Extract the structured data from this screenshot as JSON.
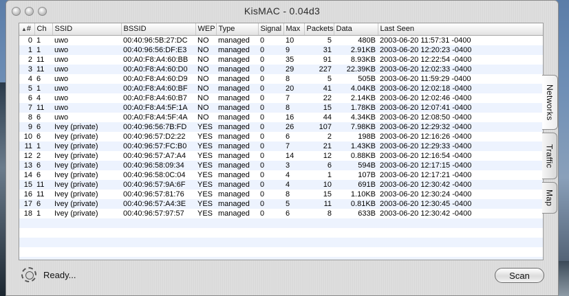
{
  "window": {
    "title": "KisMAC - 0.04d3"
  },
  "columns": {
    "sort": "▲",
    "num": "#",
    "ch": "Ch",
    "ssid": "SSID",
    "bssid": "BSSID",
    "wep": "WEP",
    "type": "Type",
    "signal": "Signal",
    "max": "Max",
    "packets": "Packets",
    "data": "Data",
    "last_seen": "Last Seen"
  },
  "rows": [
    {
      "num": "0",
      "ch": "1",
      "ssid": "uwo",
      "bssid": "00:40:96:5B:27:DC",
      "wep": "NO",
      "type": "managed",
      "signal": "0",
      "max": "10",
      "packets": "5",
      "data": "480B",
      "last_seen": "2003-06-20 11:57:31 -0400"
    },
    {
      "num": "1",
      "ch": "1",
      "ssid": "uwo",
      "bssid": "00:40:96:56:DF:E3",
      "wep": "NO",
      "type": "managed",
      "signal": "0",
      "max": "9",
      "packets": "31",
      "data": "2.91KB",
      "last_seen": "2003-06-20 12:20:23 -0400"
    },
    {
      "num": "2",
      "ch": "11",
      "ssid": "uwo",
      "bssid": "00:A0:F8:A4:60:BB",
      "wep": "NO",
      "type": "managed",
      "signal": "0",
      "max": "35",
      "packets": "91",
      "data": "8.93KB",
      "last_seen": "2003-06-20 12:22:54 -0400"
    },
    {
      "num": "3",
      "ch": "11",
      "ssid": "uwo",
      "bssid": "00:A0:F8:A4:60:D0",
      "wep": "NO",
      "type": "managed",
      "signal": "0",
      "max": "29",
      "packets": "227",
      "data": "22.39KB",
      "last_seen": "2003-06-20 12:02:33 -0400"
    },
    {
      "num": "4",
      "ch": "6",
      "ssid": "uwo",
      "bssid": "00:A0:F8:A4:60:D9",
      "wep": "NO",
      "type": "managed",
      "signal": "0",
      "max": "8",
      "packets": "5",
      "data": "505B",
      "last_seen": "2003-06-20 11:59:29 -0400"
    },
    {
      "num": "5",
      "ch": "1",
      "ssid": "uwo",
      "bssid": "00:A0:F8:A4:60:BF",
      "wep": "NO",
      "type": "managed",
      "signal": "0",
      "max": "20",
      "packets": "41",
      "data": "4.04KB",
      "last_seen": "2003-06-20 12:02:18 -0400"
    },
    {
      "num": "6",
      "ch": "4",
      "ssid": "uwo",
      "bssid": "00:A0:F8:A4:60:B7",
      "wep": "NO",
      "type": "managed",
      "signal": "0",
      "max": "7",
      "packets": "22",
      "data": "2.14KB",
      "last_seen": "2003-06-20 12:02:46 -0400"
    },
    {
      "num": "7",
      "ch": "11",
      "ssid": "uwo",
      "bssid": "00:A0:F8:A4:5F:1A",
      "wep": "NO",
      "type": "managed",
      "signal": "0",
      "max": "8",
      "packets": "15",
      "data": "1.78KB",
      "last_seen": "2003-06-20 12:07:41 -0400"
    },
    {
      "num": "8",
      "ch": "6",
      "ssid": "uwo",
      "bssid": "00:A0:F8:A4:5F:4A",
      "wep": "NO",
      "type": "managed",
      "signal": "0",
      "max": "16",
      "packets": "44",
      "data": "4.34KB",
      "last_seen": "2003-06-20 12:08:50 -0400"
    },
    {
      "num": "9",
      "ch": "6",
      "ssid": "Ivey (private)",
      "bssid": "00:40:96:56:7B:FD",
      "wep": "YES",
      "type": "managed",
      "signal": "0",
      "max": "26",
      "packets": "107",
      "data": "7.98KB",
      "last_seen": "2003-06-20 12:29:32 -0400"
    },
    {
      "num": "10",
      "ch": "6",
      "ssid": "Ivey (private)",
      "bssid": "00:40:96:57:D2:22",
      "wep": "YES",
      "type": "managed",
      "signal": "0",
      "max": "6",
      "packets": "2",
      "data": "198B",
      "last_seen": "2003-06-20 12:16:26 -0400"
    },
    {
      "num": "11",
      "ch": "1",
      "ssid": "Ivey (private)",
      "bssid": "00:40:96:57:FC:B0",
      "wep": "YES",
      "type": "managed",
      "signal": "0",
      "max": "7",
      "packets": "21",
      "data": "1.43KB",
      "last_seen": "2003-06-20 12:29:33 -0400"
    },
    {
      "num": "12",
      "ch": "2",
      "ssid": "Ivey (private)",
      "bssid": "00:40:96:57:A7:A4",
      "wep": "YES",
      "type": "managed",
      "signal": "0",
      "max": "14",
      "packets": "12",
      "data": "0.88KB",
      "last_seen": "2003-06-20 12:16:54 -0400"
    },
    {
      "num": "13",
      "ch": "6",
      "ssid": "Ivey (private)",
      "bssid": "00:40:96:58:09:34",
      "wep": "YES",
      "type": "managed",
      "signal": "0",
      "max": "3",
      "packets": "6",
      "data": "594B",
      "last_seen": "2003-06-20 12:17:15 -0400"
    },
    {
      "num": "14",
      "ch": "6",
      "ssid": "Ivey (private)",
      "bssid": "00:40:96:58:0C:04",
      "wep": "YES",
      "type": "managed",
      "signal": "0",
      "max": "4",
      "packets": "1",
      "data": "107B",
      "last_seen": "2003-06-20 12:17:21 -0400"
    },
    {
      "num": "15",
      "ch": "11",
      "ssid": "Ivey (private)",
      "bssid": "00:40:96:57:9A:6F",
      "wep": "YES",
      "type": "managed",
      "signal": "0",
      "max": "4",
      "packets": "10",
      "data": "691B",
      "last_seen": "2003-06-20 12:30:42 -0400"
    },
    {
      "num": "16",
      "ch": "11",
      "ssid": "Ivey (private)",
      "bssid": "00:40:96:57:81:76",
      "wep": "YES",
      "type": "managed",
      "signal": "0",
      "max": "8",
      "packets": "15",
      "data": "1.10KB",
      "last_seen": "2003-06-20 12:30:24 -0400"
    },
    {
      "num": "17",
      "ch": "6",
      "ssid": "Ivey (private)",
      "bssid": "00:40:96:57:A4:3E",
      "wep": "YES",
      "type": "managed",
      "signal": "0",
      "max": "5",
      "packets": "11",
      "data": "0.81KB",
      "last_seen": "2003-06-20 12:30:45 -0400"
    },
    {
      "num": "18",
      "ch": "1",
      "ssid": "Ivey (private)",
      "bssid": "00:40:96:57:97:57",
      "wep": "YES",
      "type": "managed",
      "signal": "0",
      "max": "6",
      "packets": "8",
      "data": "633B",
      "last_seen": "2003-06-20 12:30:42 -0400"
    }
  ],
  "tabs": [
    {
      "label": "Networks",
      "active": true
    },
    {
      "label": "Traffic",
      "active": false
    },
    {
      "label": "Map",
      "active": false
    }
  ],
  "status": {
    "text": "Ready...",
    "icon": "gear-icon"
  },
  "scan_button": {
    "label": "Scan"
  }
}
